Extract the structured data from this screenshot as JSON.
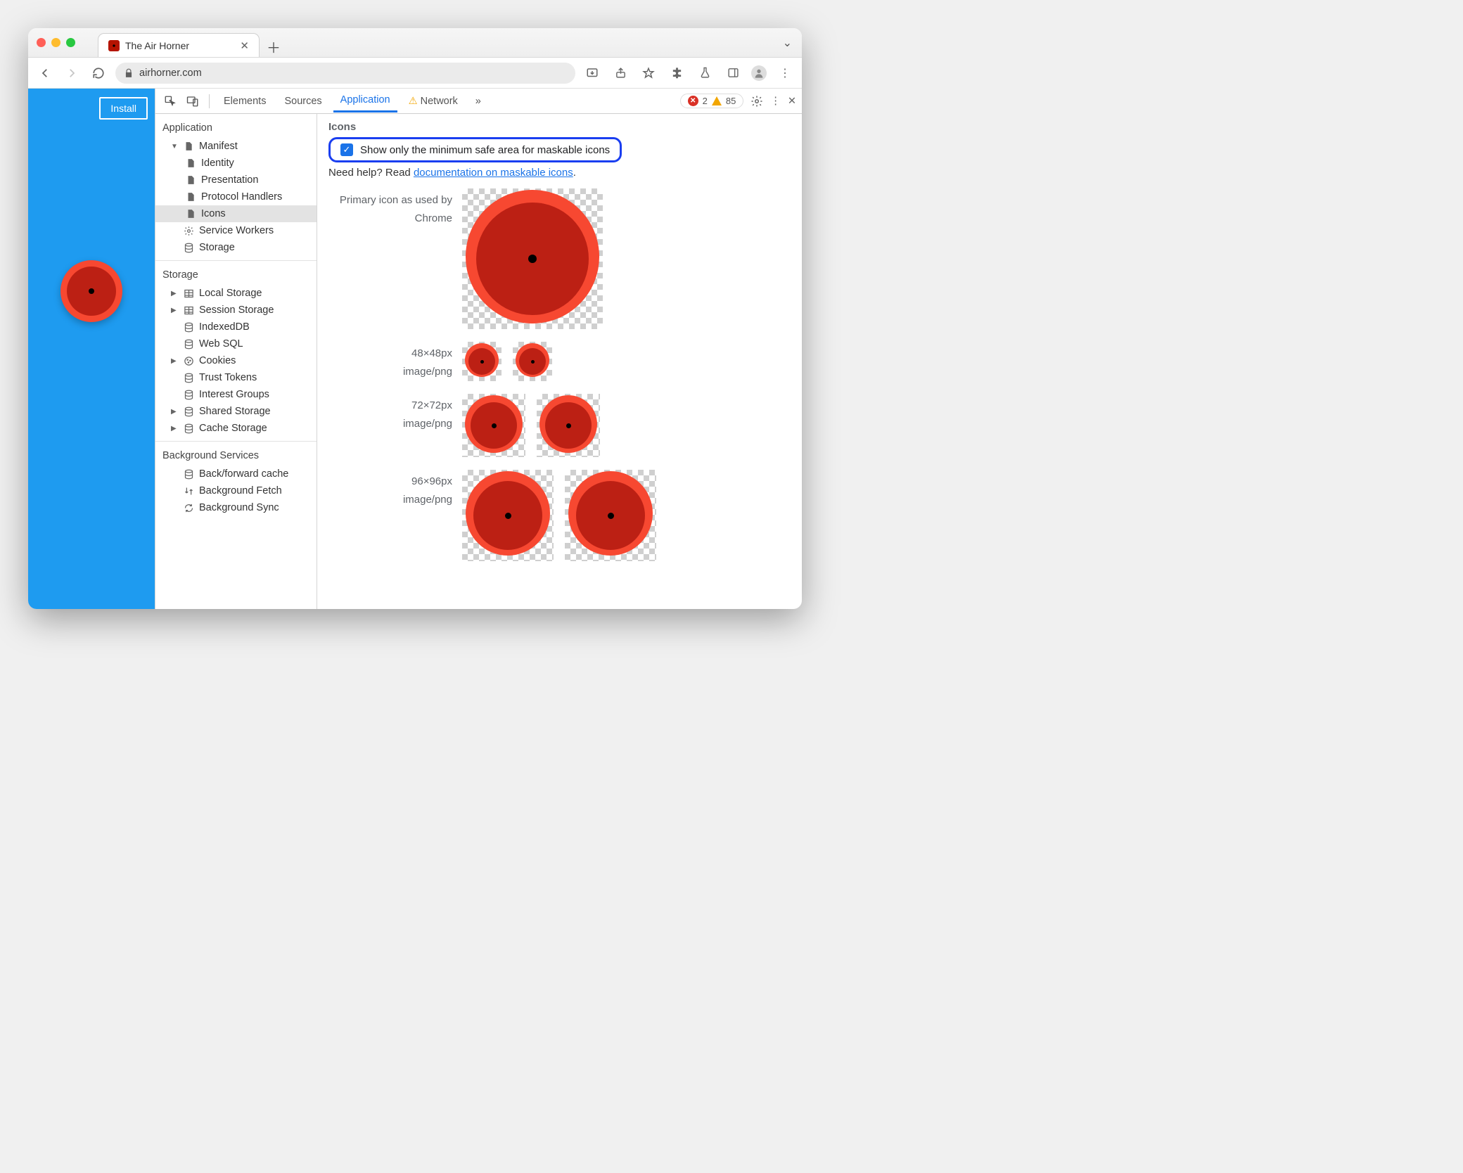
{
  "browser": {
    "tab_title": "The Air Horner",
    "url": "airhorner.com"
  },
  "page": {
    "install_label": "Install"
  },
  "devtools": {
    "tabs": [
      "Elements",
      "Sources",
      "Application",
      "Network"
    ],
    "active_tab": "Application",
    "error_count": "2",
    "warning_count": "85",
    "sidebar": {
      "application_head": "Application",
      "manifest": "Manifest",
      "identity": "Identity",
      "presentation": "Presentation",
      "protocol_handlers": "Protocol Handlers",
      "icons": "Icons",
      "service_workers": "Service Workers",
      "storage_app": "Storage",
      "storage_head": "Storage",
      "local_storage": "Local Storage",
      "session_storage": "Session Storage",
      "indexeddb": "IndexedDB",
      "websql": "Web SQL",
      "cookies": "Cookies",
      "trust_tokens": "Trust Tokens",
      "interest_groups": "Interest Groups",
      "shared_storage": "Shared Storage",
      "cache_storage": "Cache Storage",
      "bg_head": "Background Services",
      "bf_cache": "Back/forward cache",
      "bg_fetch": "Background Fetch",
      "bg_sync": "Background Sync"
    },
    "main": {
      "section_title": "Icons",
      "checkbox_label": "Show only the minimum safe area for maskable icons",
      "help_prefix": "Need help? Read ",
      "help_link": "documentation on maskable icons",
      "help_suffix": ".",
      "primary_line1": "Primary icon as used by",
      "primary_line2": "Chrome",
      "row1_size": "48×48px",
      "row1_type": "image/png",
      "row2_size": "72×72px",
      "row2_type": "image/png",
      "row3_size": "96×96px",
      "row3_type": "image/png"
    }
  }
}
